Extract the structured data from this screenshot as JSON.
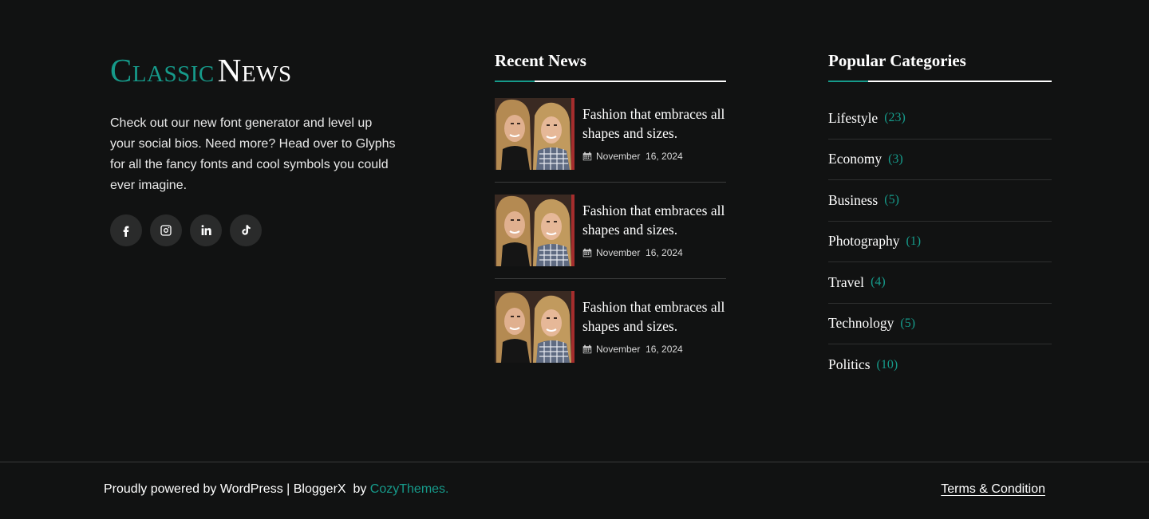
{
  "logo": {
    "part1": "Classic",
    "part2": "News"
  },
  "about": "Check out our new font generator and level up your social bios. Need more? Head over to Glyphs for all the fancy fonts and cool symbols you could ever imagine.",
  "socials": [
    {
      "icon": "facebook-icon"
    },
    {
      "icon": "instagram-icon"
    },
    {
      "icon": "linkedin-icon"
    },
    {
      "icon": "tiktok-icon"
    }
  ],
  "recent_news": {
    "title": "Recent News",
    "items": [
      {
        "title": "Fashion that embraces all shapes and sizes.",
        "date": "November  16, 2024"
      },
      {
        "title": "Fashion that embraces all shapes and sizes.",
        "date": "November  16, 2024"
      },
      {
        "title": "Fashion that embraces all shapes and sizes.",
        "date": "November  16, 2024"
      }
    ]
  },
  "categories": {
    "title": "Popular Categories",
    "items": [
      {
        "name": "Lifestyle",
        "count": "(23)"
      },
      {
        "name": "Economy",
        "count": "(3)"
      },
      {
        "name": "Business",
        "count": "(5)"
      },
      {
        "name": "Photography",
        "count": "(1)"
      },
      {
        "name": "Travel",
        "count": "(4)"
      },
      {
        "name": "Technology",
        "count": "(5)"
      },
      {
        "name": "Politics",
        "count": "(10)"
      }
    ]
  },
  "bottom": {
    "copyright_prefix": "Proudly powered by WordPress | BloggerX  by ",
    "brand": "CozyThemes.",
    "terms": "Terms & Condition"
  },
  "colors": {
    "accent": "#169a8a",
    "background": "#111212"
  }
}
